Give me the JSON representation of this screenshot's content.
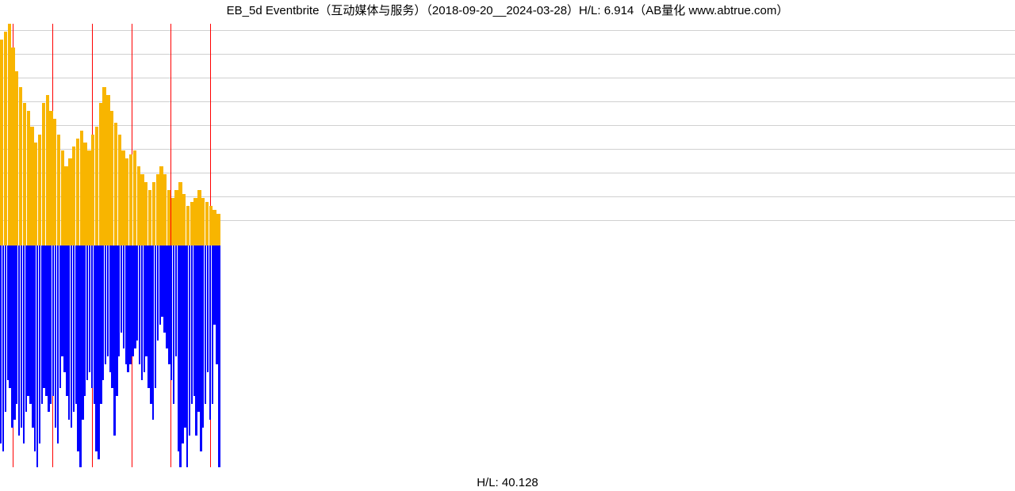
{
  "chart_data": {
    "type": "bar",
    "title": "EB_5d Eventbrite（互动媒体与服务）（2018-09-20__2024-03-28）H/L: 6.914（AB量化  www.abtrue.com）",
    "bottom_label": "H/L: 40.128",
    "date_range": [
      "2018-09-20",
      "2024-03-28"
    ],
    "hl_top": 6.914,
    "hl_bottom": 40.128,
    "source": "AB量化  www.abtrue.com",
    "red_line_x_positions": [
      16,
      66,
      116,
      166,
      215,
      265
    ],
    "gridline_y_positions": [
      8,
      38,
      68,
      98,
      128,
      158,
      188,
      218,
      248
    ],
    "orange_series": [
      260,
      270,
      280,
      250,
      220,
      200,
      180,
      170,
      150,
      130,
      140,
      180,
      190,
      170,
      160,
      140,
      120,
      100,
      110,
      125,
      135,
      145,
      130,
      120,
      140,
      150,
      180,
      200,
      190,
      170,
      155,
      140,
      120,
      110,
      115,
      120,
      100,
      90,
      80,
      70,
      80,
      90,
      100,
      90,
      70,
      60,
      70,
      80,
      65,
      50,
      55,
      60,
      70,
      60,
      55,
      50,
      45,
      40
    ],
    "blue_series": [
      250,
      260,
      210,
      170,
      180,
      230,
      220,
      200,
      240,
      230,
      250,
      210,
      190,
      200,
      230,
      260,
      280,
      250,
      200,
      180,
      190,
      210,
      200,
      190,
      230,
      250,
      180,
      140,
      160,
      190,
      220,
      230,
      210,
      200,
      260,
      280,
      220,
      190,
      170,
      160,
      180,
      200,
      260,
      270,
      200,
      170,
      150,
      140,
      160,
      180,
      240,
      190,
      140,
      110,
      130,
      150,
      160,
      150,
      140,
      130,
      120,
      150,
      170,
      160,
      140,
      180,
      200,
      220,
      180,
      120,
      100,
      90,
      110,
      130,
      150,
      170,
      200,
      140,
      260,
      280,
      250,
      230,
      280,
      240,
      200,
      190,
      240,
      210,
      260,
      230,
      200,
      160,
      220,
      200,
      100,
      150,
      280
    ],
    "orange_max": 280,
    "blue_max": 280
  }
}
